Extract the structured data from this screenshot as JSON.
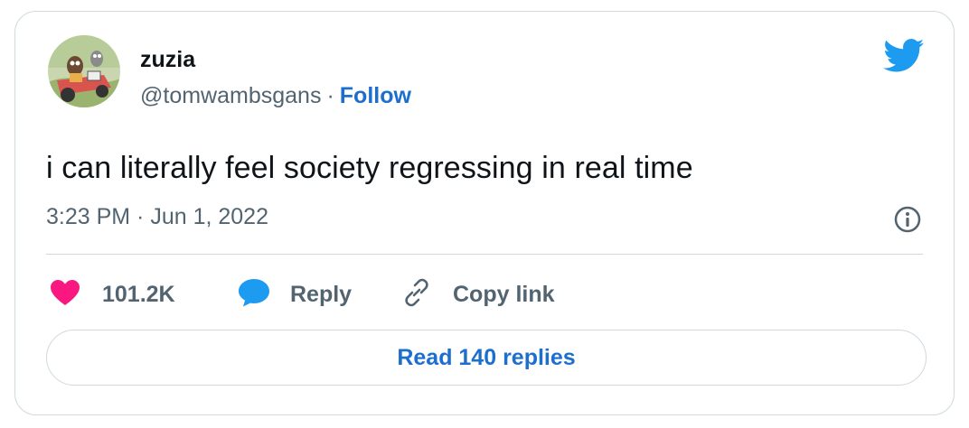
{
  "author": {
    "name": "zuzia",
    "handle": "@tomwambsgans",
    "separator": "·",
    "follow_label": "Follow"
  },
  "tweet": {
    "text": "i can literally feel society regressing in real time",
    "timestamp": "3:23 PM · Jun 1, 2022"
  },
  "actions": {
    "like_count": "101.2K",
    "reply_label": "Reply",
    "copy_label": "Copy link"
  },
  "read_replies_label": "Read 140 replies",
  "icons": {
    "brand": "twitter-bird-icon",
    "info": "info-icon",
    "like": "heart-icon",
    "reply": "speech-bubble-icon",
    "copy": "link-icon"
  },
  "colors": {
    "accent": "#1d9bf0",
    "link": "#1d6fce",
    "like": "#f91880",
    "muted": "#536471",
    "border": "#cfd9de"
  }
}
